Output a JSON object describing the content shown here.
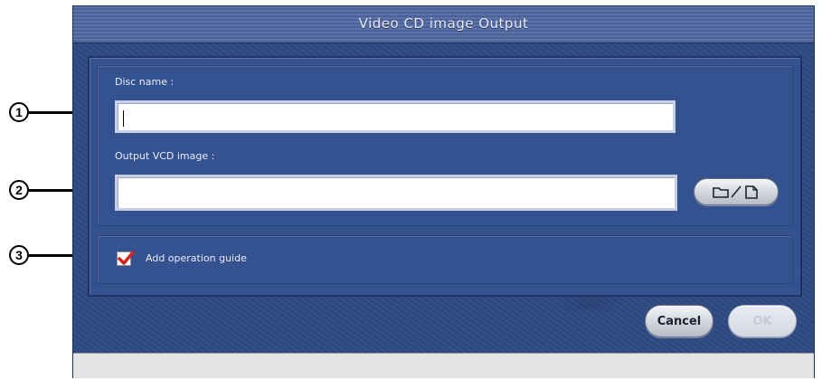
{
  "window": {
    "title": "Video CD image Output"
  },
  "form": {
    "disc_name_label": "Disc name :",
    "disc_name_value": "",
    "output_label": "Output VCD image :",
    "output_value": "",
    "browse_icons": "folder-icon / document-icon",
    "add_guide_label": "Add operation guide",
    "add_guide_checked": true
  },
  "buttons": {
    "cancel": "Cancel",
    "ok": "OK"
  },
  "callouts": {
    "one": "1",
    "two": "2",
    "three": "3"
  },
  "colors": {
    "window_bg": "#2e4a83",
    "check_mark": "#d62020"
  }
}
